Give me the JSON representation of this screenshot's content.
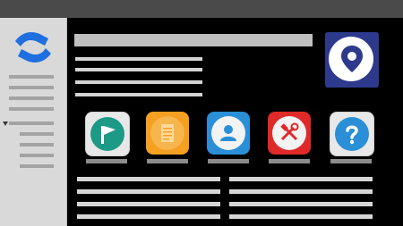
{
  "colors": {
    "background": "#000000",
    "topbar": "#4a4a4a",
    "sidebar": "#d9d9d9",
    "logo": "#1f6fe0",
    "location_tile": "#2d3a8c"
  },
  "logo": {
    "icon": "confluence-logo"
  },
  "location_tile": {
    "icon": "map-pin-icon"
  },
  "app_tiles": [
    {
      "icon": "flag-icon",
      "color": "#1c9a86",
      "accent": "#1c9a86"
    },
    {
      "icon": "document-icon",
      "color": "#f5a020",
      "accent": "#f5a020"
    },
    {
      "icon": "user-icon",
      "color": "#2a8fd6",
      "accent": "#2a8fd6"
    },
    {
      "icon": "tools-icon",
      "color": "#e02a2a",
      "accent": "#e02a2a"
    },
    {
      "icon": "help-icon",
      "color": "#2a8fd6",
      "accent": "#2a8fd6"
    }
  ]
}
